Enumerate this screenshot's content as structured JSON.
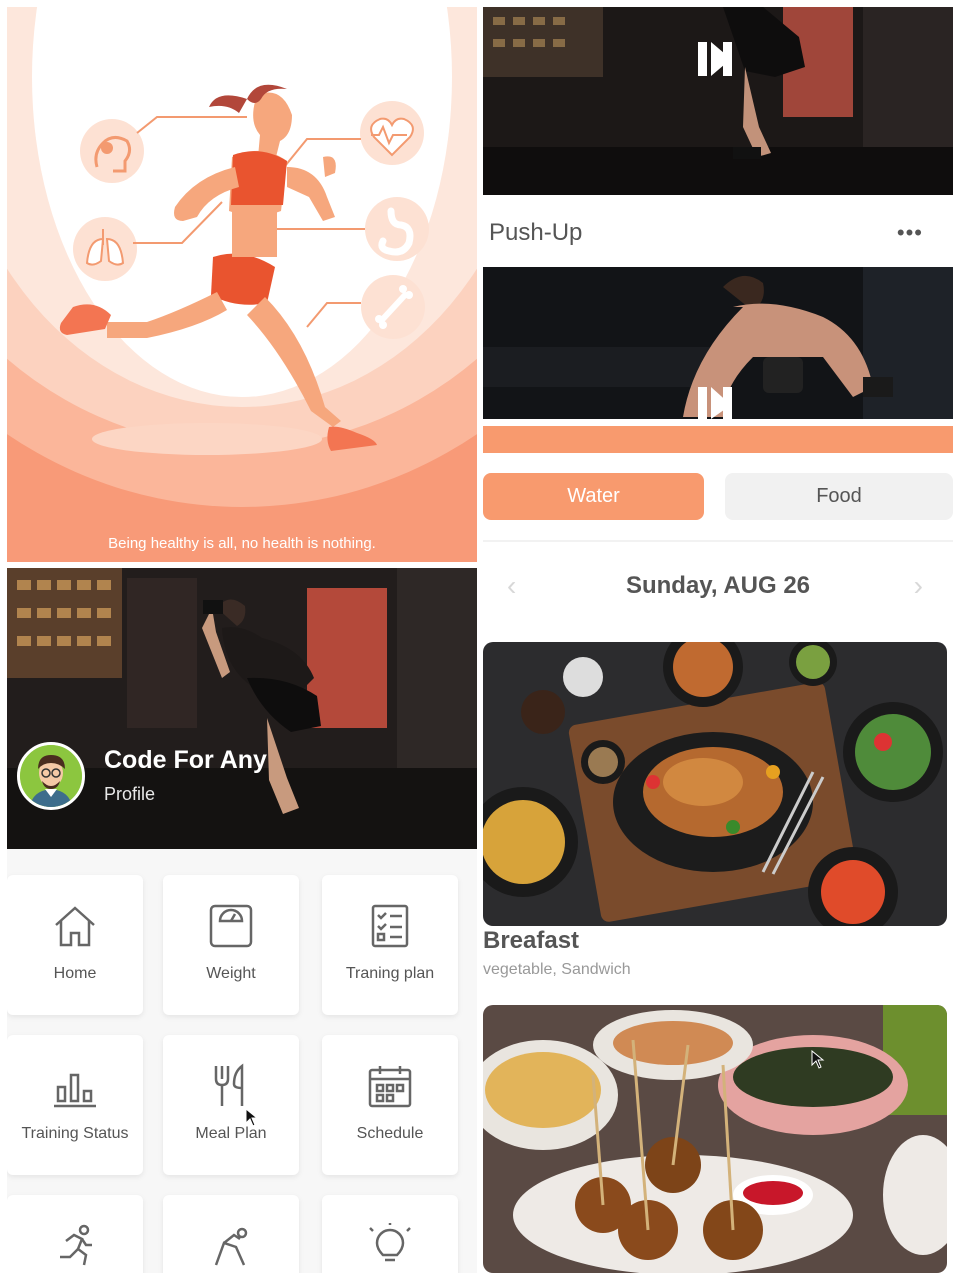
{
  "splash": {
    "tagline": "Being healthy is all, no health is nothing."
  },
  "profile": {
    "name": "Code For Any",
    "subtitle": "Profile"
  },
  "menu": {
    "items": [
      {
        "label": "Home",
        "icon": "home-icon"
      },
      {
        "label": "Weight",
        "icon": "scale-icon"
      },
      {
        "label": "Traning plan",
        "icon": "checklist-icon"
      },
      {
        "label": "Training Status",
        "icon": "bar-chart-icon"
      },
      {
        "label": "Meal Plan",
        "icon": "fork-knife-icon"
      },
      {
        "label": "Schedule",
        "icon": "calendar-icon"
      },
      {
        "label": "",
        "icon": "running-icon"
      },
      {
        "label": "",
        "icon": "stretching-icon"
      },
      {
        "label": "",
        "icon": "lightbulb-icon"
      }
    ]
  },
  "workout": {
    "exercise_title": "Push-Up",
    "more_label": "•••"
  },
  "food": {
    "tabs": {
      "water": "Water",
      "food": "Food"
    },
    "date": "Sunday, AUG 26",
    "meal": {
      "title": "Breafast",
      "description": "vegetable, Sandwich"
    }
  },
  "colors": {
    "accent": "#f89a6e",
    "text": "#555555",
    "tile_bg": "#ffffff"
  }
}
